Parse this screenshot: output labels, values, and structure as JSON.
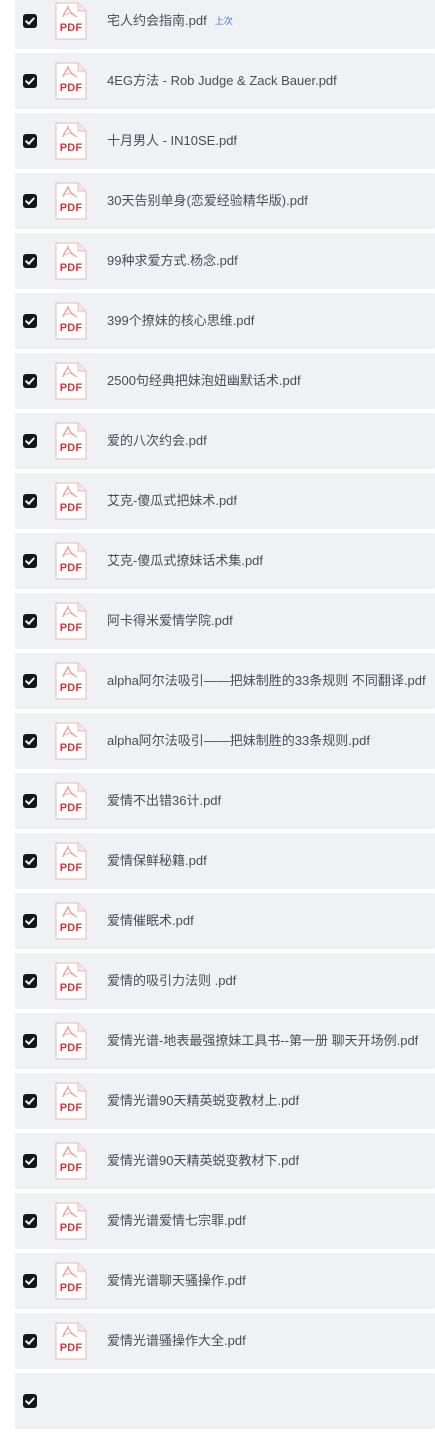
{
  "files": [
    {
      "name": "宅人约会指南.pdf",
      "tag": "上次",
      "type_label": "PDF",
      "checked": true
    },
    {
      "name": "4EG方法 - Rob Judge & Zack Bauer.pdf",
      "type_label": "PDF",
      "checked": true
    },
    {
      "name": "十月男人 - IN10SE.pdf",
      "type_label": "PDF",
      "checked": true
    },
    {
      "name": "30天告别单身(恋爱经验精华版).pdf",
      "type_label": "PDF",
      "checked": true
    },
    {
      "name": "99种求爱方式.杨念.pdf",
      "type_label": "PDF",
      "checked": true
    },
    {
      "name": "399个撩妹的核心思维.pdf",
      "type_label": "PDF",
      "checked": true
    },
    {
      "name": "2500句经典把妹泡妞幽默话术.pdf",
      "type_label": "PDF",
      "checked": true
    },
    {
      "name": "爱的八次约会.pdf",
      "type_label": "PDF",
      "checked": true
    },
    {
      "name": "艾克-傻瓜式把妹术.pdf",
      "type_label": "PDF",
      "checked": true
    },
    {
      "name": "艾克-傻瓜式撩妹话术集.pdf",
      "type_label": "PDF",
      "checked": true
    },
    {
      "name": "阿卡得米爱情学院.pdf",
      "type_label": "PDF",
      "checked": true
    },
    {
      "name": "alpha阿尔法吸引——把妹制胜的33条规则 不同翻译.pdf",
      "type_label": "PDF",
      "checked": true
    },
    {
      "name": "alpha阿尔法吸引——把妹制胜的33条规则.pdf",
      "type_label": "PDF",
      "checked": true
    },
    {
      "name": "爱情不出错36计.pdf",
      "type_label": "PDF",
      "checked": true
    },
    {
      "name": "爱情保鲜秘籍.pdf",
      "type_label": "PDF",
      "checked": true
    },
    {
      "name": "爱情催眠术.pdf",
      "type_label": "PDF",
      "checked": true
    },
    {
      "name": "爱情的吸引力法则 .pdf",
      "type_label": "PDF",
      "checked": true
    },
    {
      "name": "爱情光谱-地表最强撩妹工具书--第一册 聊天开场例.pdf",
      "type_label": "PDF",
      "checked": true
    },
    {
      "name": "爱情光谱90天精英蜕变教材上.pdf",
      "type_label": "PDF",
      "checked": true
    },
    {
      "name": "爱情光谱90天精英蜕变教材下.pdf",
      "type_label": "PDF",
      "checked": true
    },
    {
      "name": "爱情光谱爱情七宗罪.pdf",
      "type_label": "PDF",
      "checked": true
    },
    {
      "name": "爱情光谱聊天骚操作.pdf",
      "type_label": "PDF",
      "checked": true
    },
    {
      "name": "爱情光谱骚操作大全.pdf",
      "type_label": "PDF",
      "checked": true
    },
    {
      "name": "",
      "type_label": "",
      "checked": true,
      "partial": true
    }
  ],
  "colors": {
    "row_bg": "#f0f1f5",
    "checkbox": "#16161e",
    "pdf_red": "#d93737",
    "text": "#4a4d57",
    "tag": "#3a78e0"
  }
}
